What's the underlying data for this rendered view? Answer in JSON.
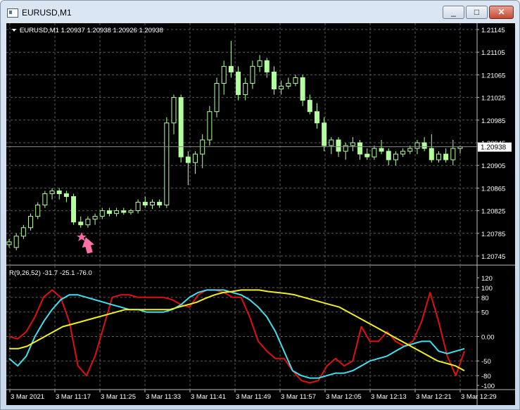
{
  "window": {
    "title": "EURUSD,M1",
    "minimize_glyph": "_",
    "maximize_glyph": "□",
    "close_glyph": "✕"
  },
  "main_chart": {
    "header": "EURUSD,M1  1.20937 1.20938 1.20926 1.20938",
    "current_price": "1.20938",
    "price_axis": [
      "1.21145",
      "1.21105",
      "1.21065",
      "1.21025",
      "1.20985",
      "1.20945",
      "1.20905",
      "1.20865",
      "1.20825",
      "1.20785",
      "1.20745"
    ],
    "signal_markers": [
      "star-icon",
      "arrow-up-icon"
    ]
  },
  "indicator": {
    "header": "R(9,26,52) -31.7 -25.1 -76.0",
    "axis": [
      "120",
      "100",
      "80",
      "50",
      "0.00",
      "-50",
      "-80",
      "-100"
    ]
  },
  "time_axis": [
    "3 Mar 2021",
    "3 Mar 11:17",
    "3 Mar 11:25",
    "3 Mar 11:33",
    "3 Mar 11:41",
    "3 Mar 11:49",
    "3 Mar 11:57",
    "3 Mar 12:05",
    "3 Mar 12:13",
    "3 Mar 12:21",
    "3 Mar 12:29"
  ],
  "colors": {
    "background": "#000000",
    "grid": "#5a5a5a",
    "candle": "#b4ff9e",
    "text": "#ffffff",
    "red": "#e01010",
    "cyan": "#40e0f0",
    "yellow": "#f0f020",
    "star": "#ff66aa",
    "arrow": "#ff6fa8"
  },
  "chart_data": {
    "type": "candlestick",
    "symbol": "EURUSD",
    "timeframe": "M1",
    "price_range": [
      1.20745,
      1.21145
    ],
    "last": 1.20938,
    "candles": [
      {
        "o": 1.20765,
        "h": 1.20775,
        "l": 1.2076,
        "c": 1.2077
      },
      {
        "o": 1.2076,
        "h": 1.20785,
        "l": 1.20755,
        "c": 1.2078
      },
      {
        "o": 1.2078,
        "h": 1.208,
        "l": 1.20775,
        "c": 1.20795
      },
      {
        "o": 1.20795,
        "h": 1.2082,
        "l": 1.2079,
        "c": 1.20815
      },
      {
        "o": 1.20815,
        "h": 1.2084,
        "l": 1.2081,
        "c": 1.20835
      },
      {
        "o": 1.20835,
        "h": 1.2086,
        "l": 1.2083,
        "c": 1.20855
      },
      {
        "o": 1.20855,
        "h": 1.20865,
        "l": 1.20845,
        "c": 1.2086
      },
      {
        "o": 1.2086,
        "h": 1.20865,
        "l": 1.20845,
        "c": 1.20855
      },
      {
        "o": 1.20855,
        "h": 1.2086,
        "l": 1.2084,
        "c": 1.2085
      },
      {
        "o": 1.2085,
        "h": 1.20855,
        "l": 1.208,
        "c": 1.20805
      },
      {
        "o": 1.20805,
        "h": 1.20815,
        "l": 1.20795,
        "c": 1.208
      },
      {
        "o": 1.208,
        "h": 1.20815,
        "l": 1.20795,
        "c": 1.2081
      },
      {
        "o": 1.2081,
        "h": 1.2082,
        "l": 1.208,
        "c": 1.20815
      },
      {
        "o": 1.20815,
        "h": 1.2083,
        "l": 1.2081,
        "c": 1.20825
      },
      {
        "o": 1.20825,
        "h": 1.2083,
        "l": 1.20815,
        "c": 1.2082
      },
      {
        "o": 1.2082,
        "h": 1.2083,
        "l": 1.20815,
        "c": 1.20825
      },
      {
        "o": 1.20825,
        "h": 1.2083,
        "l": 1.20818,
        "c": 1.20822
      },
      {
        "o": 1.20822,
        "h": 1.20828,
        "l": 1.20818,
        "c": 1.20825
      },
      {
        "o": 1.20825,
        "h": 1.20845,
        "l": 1.2082,
        "c": 1.2084
      },
      {
        "o": 1.2084,
        "h": 1.2085,
        "l": 1.2083,
        "c": 1.20835
      },
      {
        "o": 1.20835,
        "h": 1.20845,
        "l": 1.20828,
        "c": 1.2084
      },
      {
        "o": 1.2084,
        "h": 1.20845,
        "l": 1.2083,
        "c": 1.20835
      },
      {
        "o": 1.20835,
        "h": 1.2099,
        "l": 1.2083,
        "c": 1.2098
      },
      {
        "o": 1.2098,
        "h": 1.2103,
        "l": 1.2096,
        "c": 1.21025
      },
      {
        "o": 1.21025,
        "h": 1.2103,
        "l": 1.2091,
        "c": 1.2092
      },
      {
        "o": 1.2092,
        "h": 1.2093,
        "l": 1.2087,
        "c": 1.2091
      },
      {
        "o": 1.2091,
        "h": 1.2093,
        "l": 1.2089,
        "c": 1.20925
      },
      {
        "o": 1.20925,
        "h": 1.2096,
        "l": 1.209,
        "c": 1.2095
      },
      {
        "o": 1.2095,
        "h": 1.2101,
        "l": 1.2094,
        "c": 1.21
      },
      {
        "o": 1.21,
        "h": 1.2106,
        "l": 1.2099,
        "c": 1.2105
      },
      {
        "o": 1.2105,
        "h": 1.2109,
        "l": 1.2103,
        "c": 1.2108
      },
      {
        "o": 1.2108,
        "h": 1.21125,
        "l": 1.2106,
        "c": 1.2107
      },
      {
        "o": 1.2107,
        "h": 1.2108,
        "l": 1.2102,
        "c": 1.2103
      },
      {
        "o": 1.2103,
        "h": 1.2106,
        "l": 1.2102,
        "c": 1.2105
      },
      {
        "o": 1.2105,
        "h": 1.2109,
        "l": 1.2104,
        "c": 1.2108
      },
      {
        "o": 1.2108,
        "h": 1.211,
        "l": 1.2107,
        "c": 1.2109
      },
      {
        "o": 1.2109,
        "h": 1.21095,
        "l": 1.2106,
        "c": 1.2107
      },
      {
        "o": 1.2107,
        "h": 1.2108,
        "l": 1.2103,
        "c": 1.2104
      },
      {
        "o": 1.2104,
        "h": 1.21055,
        "l": 1.2103,
        "c": 1.21045
      },
      {
        "o": 1.21045,
        "h": 1.2106,
        "l": 1.2104,
        "c": 1.2105
      },
      {
        "o": 1.2105,
        "h": 1.21065,
        "l": 1.21045,
        "c": 1.2106
      },
      {
        "o": 1.2106,
        "h": 1.21065,
        "l": 1.2101,
        "c": 1.2102
      },
      {
        "o": 1.2102,
        "h": 1.2103,
        "l": 1.20995,
        "c": 1.21
      },
      {
        "o": 1.21,
        "h": 1.21015,
        "l": 1.2097,
        "c": 1.2098
      },
      {
        "o": 1.2098,
        "h": 1.2099,
        "l": 1.2093,
        "c": 1.2094
      },
      {
        "o": 1.2094,
        "h": 1.20955,
        "l": 1.20925,
        "c": 1.2095
      },
      {
        "o": 1.2095,
        "h": 1.20955,
        "l": 1.2092,
        "c": 1.2093
      },
      {
        "o": 1.2093,
        "h": 1.20945,
        "l": 1.20915,
        "c": 1.2094
      },
      {
        "o": 1.2094,
        "h": 1.20955,
        "l": 1.2093,
        "c": 1.20945
      },
      {
        "o": 1.20945,
        "h": 1.2095,
        "l": 1.20915,
        "c": 1.20925
      },
      {
        "o": 1.20925,
        "h": 1.20935,
        "l": 1.20915,
        "c": 1.2092
      },
      {
        "o": 1.2092,
        "h": 1.2094,
        "l": 1.20915,
        "c": 1.20935
      },
      {
        "o": 1.20935,
        "h": 1.2095,
        "l": 1.20925,
        "c": 1.2093
      },
      {
        "o": 1.2093,
        "h": 1.20935,
        "l": 1.20905,
        "c": 1.20915
      },
      {
        "o": 1.20915,
        "h": 1.2093,
        "l": 1.20905,
        "c": 1.20925
      },
      {
        "o": 1.20925,
        "h": 1.20935,
        "l": 1.2092,
        "c": 1.2093
      },
      {
        "o": 1.2093,
        "h": 1.2094,
        "l": 1.20925,
        "c": 1.20935
      },
      {
        "o": 1.20935,
        "h": 1.2095,
        "l": 1.20925,
        "c": 1.20945
      },
      {
        "o": 1.20945,
        "h": 1.20955,
        "l": 1.2093,
        "c": 1.20935
      },
      {
        "o": 1.20935,
        "h": 1.2096,
        "l": 1.2091,
        "c": 1.20915
      },
      {
        "o": 1.20915,
        "h": 1.2093,
        "l": 1.2091,
        "c": 1.20925
      },
      {
        "o": 1.20925,
        "h": 1.20935,
        "l": 1.2091,
        "c": 1.20915
      },
      {
        "o": 1.20915,
        "h": 1.2095,
        "l": 1.20905,
        "c": 1.20935
      },
      {
        "o": 1.20935,
        "h": 1.2094,
        "l": 1.20926,
        "c": 1.20938
      }
    ],
    "indicator": {
      "name": "R(9,26,52)",
      "values": [
        -31.7,
        -25.1,
        -76.0
      ],
      "ylim": [
        -100,
        120
      ],
      "series": [
        {
          "color": "red",
          "values": [
            0,
            -5,
            10,
            40,
            80,
            95,
            80,
            30,
            -60,
            -80,
            -40,
            20,
            80,
            85,
            85,
            80,
            80,
            80,
            80,
            75,
            65,
            60,
            85,
            95,
            95,
            90,
            80,
            80,
            40,
            -10,
            -30,
            -45,
            -45,
            -70,
            -90,
            -95,
            -90,
            -60,
            -45,
            -60,
            -50,
            20,
            -10,
            -10,
            10,
            -10,
            -20,
            -10,
            30,
            90,
            30,
            -40,
            -80,
            -30
          ]
        },
        {
          "color": "cyan",
          "values": [
            -45,
            -60,
            -40,
            0,
            30,
            55,
            75,
            85,
            85,
            80,
            75,
            70,
            65,
            60,
            55,
            55,
            50,
            50,
            50,
            55,
            65,
            80,
            90,
            95,
            95,
            95,
            90,
            85,
            75,
            60,
            40,
            10,
            -30,
            -70,
            -80,
            -85,
            -85,
            -80,
            -75,
            -75,
            -70,
            -60,
            -50,
            -45,
            -40,
            -30,
            -20,
            -15,
            -10,
            -10,
            -30,
            -35,
            -30,
            -25
          ]
        },
        {
          "color": "yellow",
          "values": [
            -25,
            -25,
            -20,
            -10,
            0,
            10,
            20,
            25,
            30,
            35,
            40,
            45,
            50,
            55,
            55,
            55,
            55,
            55,
            55,
            60,
            65,
            70,
            78,
            85,
            90,
            92,
            95,
            95,
            95,
            92,
            90,
            88,
            85,
            80,
            75,
            70,
            65,
            60,
            50,
            40,
            30,
            20,
            10,
            0,
            -10,
            -20,
            -30,
            -40,
            -50,
            -55,
            -60,
            -70
          ]
        }
      ]
    }
  }
}
